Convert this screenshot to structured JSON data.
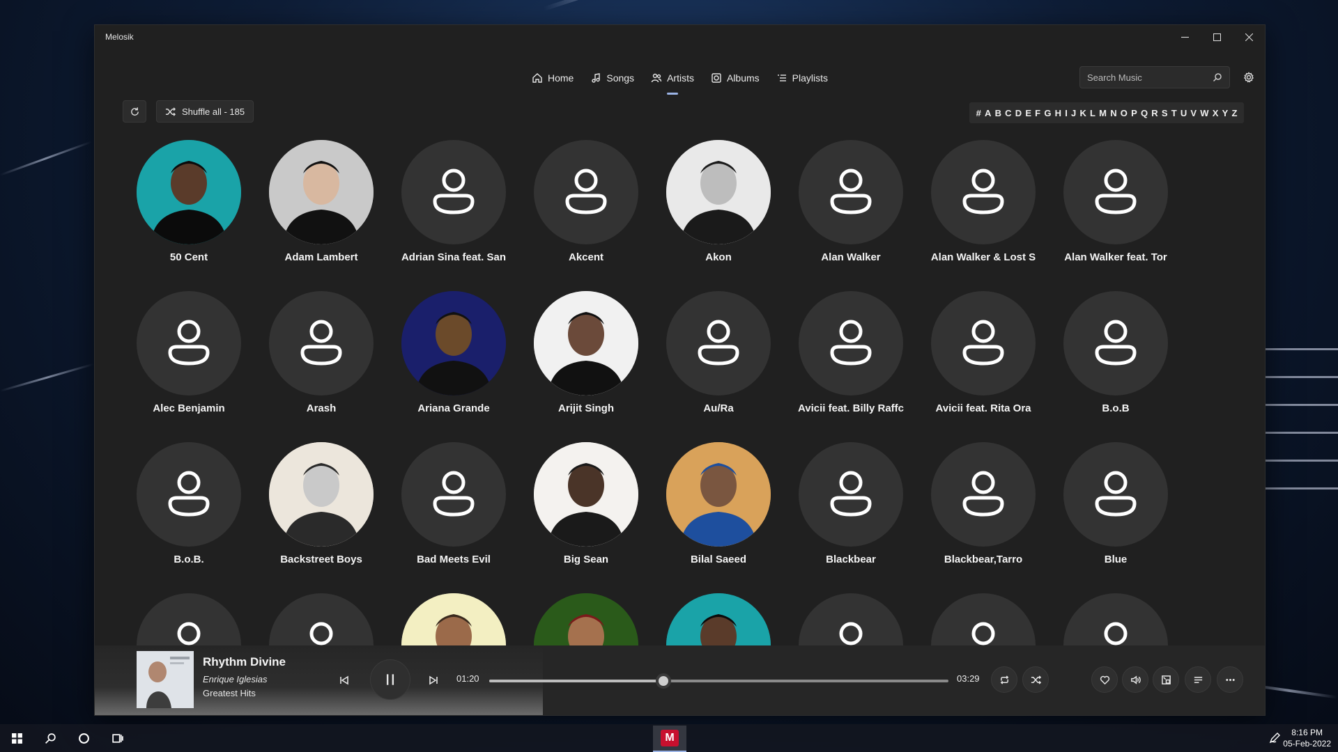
{
  "app": {
    "title": "Melosik"
  },
  "nav": [
    {
      "label": "Home",
      "icon": "home-icon"
    },
    {
      "label": "Songs",
      "icon": "music-note-icon"
    },
    {
      "label": "Artists",
      "icon": "people-icon",
      "active": true
    },
    {
      "label": "Albums",
      "icon": "album-icon"
    },
    {
      "label": "Playlists",
      "icon": "list-icon"
    }
  ],
  "search": {
    "placeholder": "Search Music"
  },
  "toolbar": {
    "shuffle_label": "Shuffle all - 185"
  },
  "alphabet": [
    "#",
    "A",
    "B",
    "C",
    "D",
    "E",
    "F",
    "G",
    "H",
    "I",
    "J",
    "K",
    "L",
    "M",
    "N",
    "O",
    "P",
    "Q",
    "R",
    "S",
    "T",
    "U",
    "V",
    "W",
    "X",
    "Y",
    "Z"
  ],
  "artists": [
    {
      "name": "50 Cent",
      "has_photo": true
    },
    {
      "name": "Adam Lambert",
      "has_photo": true
    },
    {
      "name": "Adrian Sina feat. San",
      "has_photo": false
    },
    {
      "name": "Akcent",
      "has_photo": false
    },
    {
      "name": "Akon",
      "has_photo": true
    },
    {
      "name": "Alan Walker",
      "has_photo": false
    },
    {
      "name": "Alan Walker & Lost S",
      "has_photo": false
    },
    {
      "name": "Alan Walker feat. Tor",
      "has_photo": false
    },
    {
      "name": "Alec Benjamin",
      "has_photo": false
    },
    {
      "name": "Arash",
      "has_photo": false
    },
    {
      "name": "Ariana Grande",
      "has_photo": true
    },
    {
      "name": "Arijit Singh",
      "has_photo": true
    },
    {
      "name": "Au/Ra",
      "has_photo": false
    },
    {
      "name": "Avicii feat. Billy Raffc",
      "has_photo": false
    },
    {
      "name": "Avicii feat. Rita Ora",
      "has_photo": false
    },
    {
      "name": "B.o.B",
      "has_photo": false
    },
    {
      "name": "B.o.B.",
      "has_photo": false
    },
    {
      "name": "Backstreet Boys",
      "has_photo": true
    },
    {
      "name": "Bad Meets Evil",
      "has_photo": false
    },
    {
      "name": "Big Sean",
      "has_photo": true
    },
    {
      "name": "Bilal Saeed",
      "has_photo": true
    },
    {
      "name": "Blackbear",
      "has_photo": false
    },
    {
      "name": "Blackbear,Tarro",
      "has_photo": false
    },
    {
      "name": "Blue",
      "has_photo": false
    },
    {
      "name": "",
      "has_photo": false
    },
    {
      "name": "",
      "has_photo": false
    },
    {
      "name": "",
      "has_photo": true
    },
    {
      "name": "",
      "has_photo": true
    },
    {
      "name": "",
      "has_photo": true
    },
    {
      "name": "",
      "has_photo": false
    },
    {
      "name": "",
      "has_photo": false
    },
    {
      "name": "",
      "has_photo": false
    }
  ],
  "player": {
    "title": "Rhythm Divine",
    "artist": "Enrique Iglesias",
    "album": "Greatest Hits",
    "elapsed": "01:20",
    "duration": "03:29",
    "progress": 0.38
  },
  "taskbar": {
    "time": "8:16 PM",
    "date": "05-Feb-2022",
    "app_letter": "M"
  },
  "colors": {
    "accent": "#9bb4e6",
    "window_bg": "#202020",
    "placeholder_bg": "#333333"
  }
}
